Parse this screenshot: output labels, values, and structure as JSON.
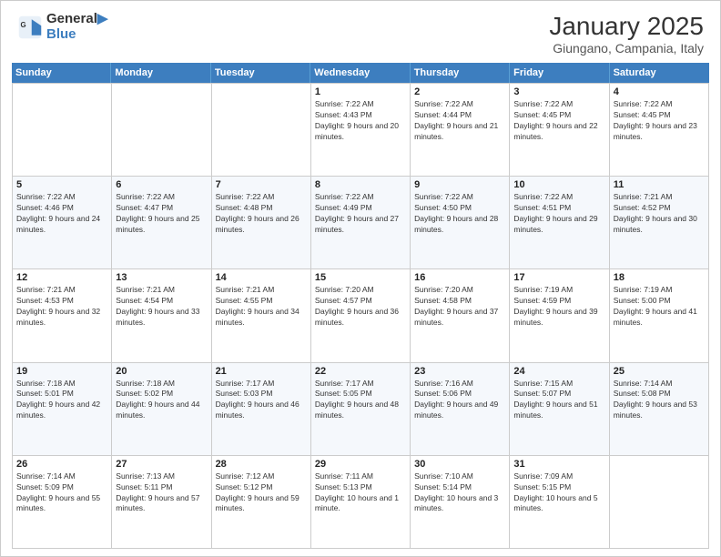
{
  "logo": {
    "line1": "General",
    "line2": "Blue"
  },
  "title": {
    "month_year": "January 2025",
    "location": "Giungano, Campania, Italy"
  },
  "days_of_week": [
    "Sunday",
    "Monday",
    "Tuesday",
    "Wednesday",
    "Thursday",
    "Friday",
    "Saturday"
  ],
  "weeks": [
    [
      {
        "day": "",
        "info": ""
      },
      {
        "day": "",
        "info": ""
      },
      {
        "day": "",
        "info": ""
      },
      {
        "day": "1",
        "info": "Sunrise: 7:22 AM\nSunset: 4:43 PM\nDaylight: 9 hours and 20 minutes."
      },
      {
        "day": "2",
        "info": "Sunrise: 7:22 AM\nSunset: 4:44 PM\nDaylight: 9 hours and 21 minutes."
      },
      {
        "day": "3",
        "info": "Sunrise: 7:22 AM\nSunset: 4:45 PM\nDaylight: 9 hours and 22 minutes."
      },
      {
        "day": "4",
        "info": "Sunrise: 7:22 AM\nSunset: 4:45 PM\nDaylight: 9 hours and 23 minutes."
      }
    ],
    [
      {
        "day": "5",
        "info": "Sunrise: 7:22 AM\nSunset: 4:46 PM\nDaylight: 9 hours and 24 minutes."
      },
      {
        "day": "6",
        "info": "Sunrise: 7:22 AM\nSunset: 4:47 PM\nDaylight: 9 hours and 25 minutes."
      },
      {
        "day": "7",
        "info": "Sunrise: 7:22 AM\nSunset: 4:48 PM\nDaylight: 9 hours and 26 minutes."
      },
      {
        "day": "8",
        "info": "Sunrise: 7:22 AM\nSunset: 4:49 PM\nDaylight: 9 hours and 27 minutes."
      },
      {
        "day": "9",
        "info": "Sunrise: 7:22 AM\nSunset: 4:50 PM\nDaylight: 9 hours and 28 minutes."
      },
      {
        "day": "10",
        "info": "Sunrise: 7:22 AM\nSunset: 4:51 PM\nDaylight: 9 hours and 29 minutes."
      },
      {
        "day": "11",
        "info": "Sunrise: 7:21 AM\nSunset: 4:52 PM\nDaylight: 9 hours and 30 minutes."
      }
    ],
    [
      {
        "day": "12",
        "info": "Sunrise: 7:21 AM\nSunset: 4:53 PM\nDaylight: 9 hours and 32 minutes."
      },
      {
        "day": "13",
        "info": "Sunrise: 7:21 AM\nSunset: 4:54 PM\nDaylight: 9 hours and 33 minutes."
      },
      {
        "day": "14",
        "info": "Sunrise: 7:21 AM\nSunset: 4:55 PM\nDaylight: 9 hours and 34 minutes."
      },
      {
        "day": "15",
        "info": "Sunrise: 7:20 AM\nSunset: 4:57 PM\nDaylight: 9 hours and 36 minutes."
      },
      {
        "day": "16",
        "info": "Sunrise: 7:20 AM\nSunset: 4:58 PM\nDaylight: 9 hours and 37 minutes."
      },
      {
        "day": "17",
        "info": "Sunrise: 7:19 AM\nSunset: 4:59 PM\nDaylight: 9 hours and 39 minutes."
      },
      {
        "day": "18",
        "info": "Sunrise: 7:19 AM\nSunset: 5:00 PM\nDaylight: 9 hours and 41 minutes."
      }
    ],
    [
      {
        "day": "19",
        "info": "Sunrise: 7:18 AM\nSunset: 5:01 PM\nDaylight: 9 hours and 42 minutes."
      },
      {
        "day": "20",
        "info": "Sunrise: 7:18 AM\nSunset: 5:02 PM\nDaylight: 9 hours and 44 minutes."
      },
      {
        "day": "21",
        "info": "Sunrise: 7:17 AM\nSunset: 5:03 PM\nDaylight: 9 hours and 46 minutes."
      },
      {
        "day": "22",
        "info": "Sunrise: 7:17 AM\nSunset: 5:05 PM\nDaylight: 9 hours and 48 minutes."
      },
      {
        "day": "23",
        "info": "Sunrise: 7:16 AM\nSunset: 5:06 PM\nDaylight: 9 hours and 49 minutes."
      },
      {
        "day": "24",
        "info": "Sunrise: 7:15 AM\nSunset: 5:07 PM\nDaylight: 9 hours and 51 minutes."
      },
      {
        "day": "25",
        "info": "Sunrise: 7:14 AM\nSunset: 5:08 PM\nDaylight: 9 hours and 53 minutes."
      }
    ],
    [
      {
        "day": "26",
        "info": "Sunrise: 7:14 AM\nSunset: 5:09 PM\nDaylight: 9 hours and 55 minutes."
      },
      {
        "day": "27",
        "info": "Sunrise: 7:13 AM\nSunset: 5:11 PM\nDaylight: 9 hours and 57 minutes."
      },
      {
        "day": "28",
        "info": "Sunrise: 7:12 AM\nSunset: 5:12 PM\nDaylight: 9 hours and 59 minutes."
      },
      {
        "day": "29",
        "info": "Sunrise: 7:11 AM\nSunset: 5:13 PM\nDaylight: 10 hours and 1 minute."
      },
      {
        "day": "30",
        "info": "Sunrise: 7:10 AM\nSunset: 5:14 PM\nDaylight: 10 hours and 3 minutes."
      },
      {
        "day": "31",
        "info": "Sunrise: 7:09 AM\nSunset: 5:15 PM\nDaylight: 10 hours and 5 minutes."
      },
      {
        "day": "",
        "info": ""
      }
    ]
  ]
}
